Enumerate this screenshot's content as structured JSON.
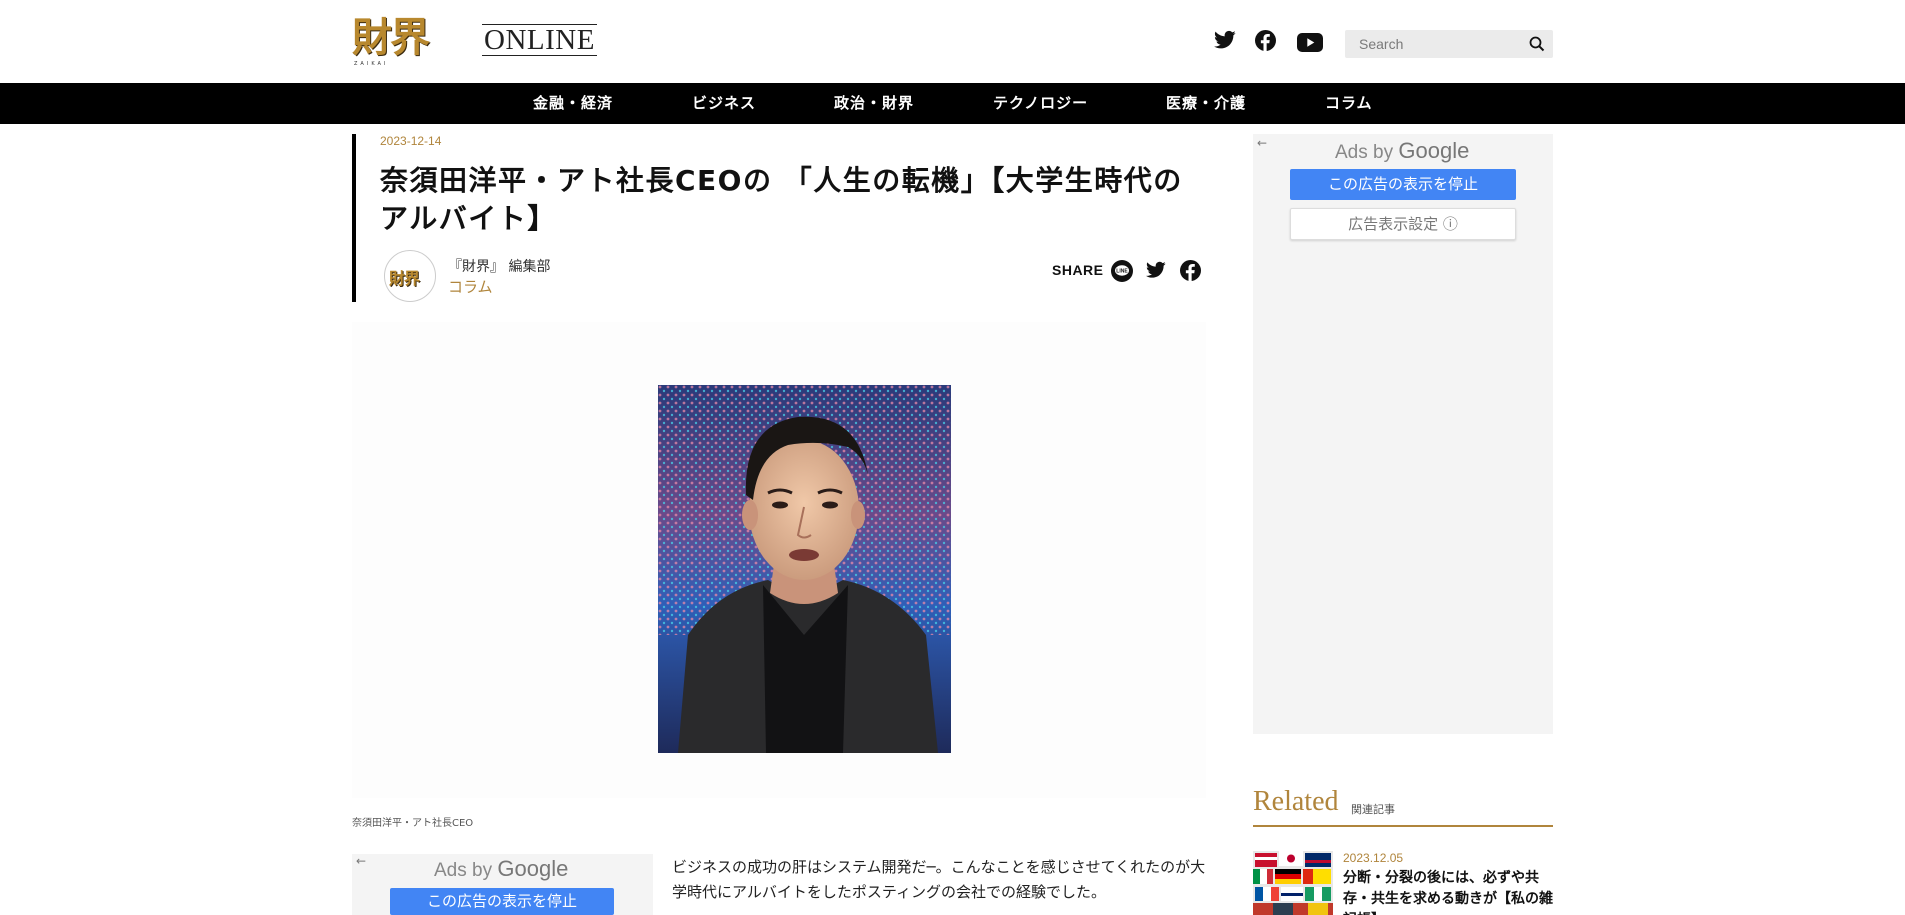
{
  "header": {
    "logo_kanji": "財界",
    "logo_sub": "ZAIKAI",
    "logo_online": "ONLINE",
    "social_icons": [
      "twitter-icon",
      "facebook-icon",
      "youtube-icon"
    ],
    "search_placeholder": "Search"
  },
  "nav": {
    "items": [
      {
        "label": "金融・経済"
      },
      {
        "label": "ビジネス"
      },
      {
        "label": "政治・財界"
      },
      {
        "label": "テクノロジー"
      },
      {
        "label": "医療・介護"
      },
      {
        "label": "コラム"
      }
    ]
  },
  "article": {
    "date": "2023-12-14",
    "title": "奈須田洋平・アト社長CEOの 「人生の転機」【大学生時代のアルバイト】",
    "author_avatar_text": "財界",
    "author": "『財界』 編集部",
    "category": "コラム",
    "share_label": "SHARE",
    "caption": "奈須田洋平・アト社長CEO",
    "body": "ビジネスの成功の肝はシステム開発だ─。こんなことを感じさせてくれたのが大学時代にアルバイトをしたポスティングの会社での経験でした。"
  },
  "side_ad": {
    "ads_by": "Ads by",
    "google": "Google",
    "stop_label": "この広告の表示を停止",
    "settings_label": "広告表示設定 ⓘ"
  },
  "inline_ad": {
    "ads_by": "Ads by",
    "google": "Google",
    "stop_label": "この広告の表示を停止"
  },
  "related": {
    "title": "Related",
    "subtitle": "関連記事",
    "items": [
      {
        "date": "2023.12.05",
        "text": "分断・分裂の後には、必ずや共存・共生を求める動きが【私の雑記帳】"
      }
    ]
  },
  "colors": {
    "accent_gold": "#b0853c",
    "nav_bg": "#000000",
    "ad_button_blue": "#4285f4"
  }
}
